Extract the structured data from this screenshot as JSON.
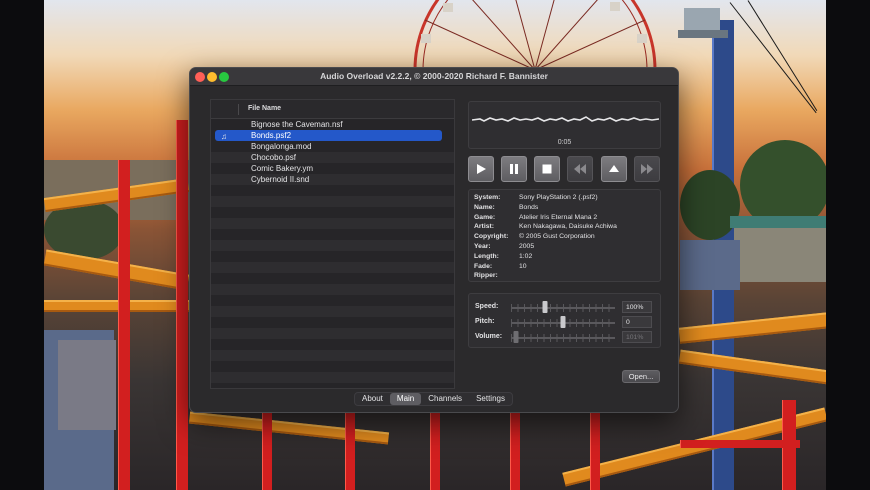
{
  "window": {
    "title": "Audio Overload v2.2.2, © 2000-2020 Richard F. Bannister"
  },
  "file_list": {
    "column_header": "File Name",
    "selected_index": 1,
    "files": [
      "Bignose the Caveman.nsf",
      "Bonds.psf2",
      "Bongalonga.mod",
      "Chocobo.psf",
      "Comic Bakery.ym",
      "Cybernoid II.snd"
    ]
  },
  "player": {
    "elapsed": "0:05",
    "buttons": [
      "play-icon",
      "pause-icon",
      "stop-icon",
      "rewind-icon",
      "eject-icon",
      "fast-forward-icon"
    ]
  },
  "track_info": [
    {
      "key": "System:",
      "value": "Sony PlayStation 2 (.psf2)"
    },
    {
      "key": "Name:",
      "value": "Bonds"
    },
    {
      "key": "Game:",
      "value": "Atelier Iris Eternal Mana 2"
    },
    {
      "key": "Artist:",
      "value": "Ken Nakagawa, Daisuke Achiwa"
    },
    {
      "key": "Copyright:",
      "value": "© 2005 Gust Corporation"
    },
    {
      "key": "Year:",
      "value": "2005"
    },
    {
      "key": "Length:",
      "value": "1:02"
    },
    {
      "key": "Fade:",
      "value": "10"
    },
    {
      "key": "Ripper:",
      "value": ""
    }
  ],
  "controls": {
    "speed": {
      "label": "Speed:",
      "value": "100%",
      "position": 0.33
    },
    "pitch": {
      "label": "Pitch:",
      "value": "0",
      "position": 0.5
    },
    "volume": {
      "label": "Volume:",
      "value": "101%",
      "position": 0.05
    }
  },
  "open_button": "Open...",
  "tabs": [
    {
      "label": "About",
      "active": false
    },
    {
      "label": "Main",
      "active": true
    },
    {
      "label": "Channels",
      "active": false
    },
    {
      "label": "Settings",
      "active": false
    }
  ]
}
